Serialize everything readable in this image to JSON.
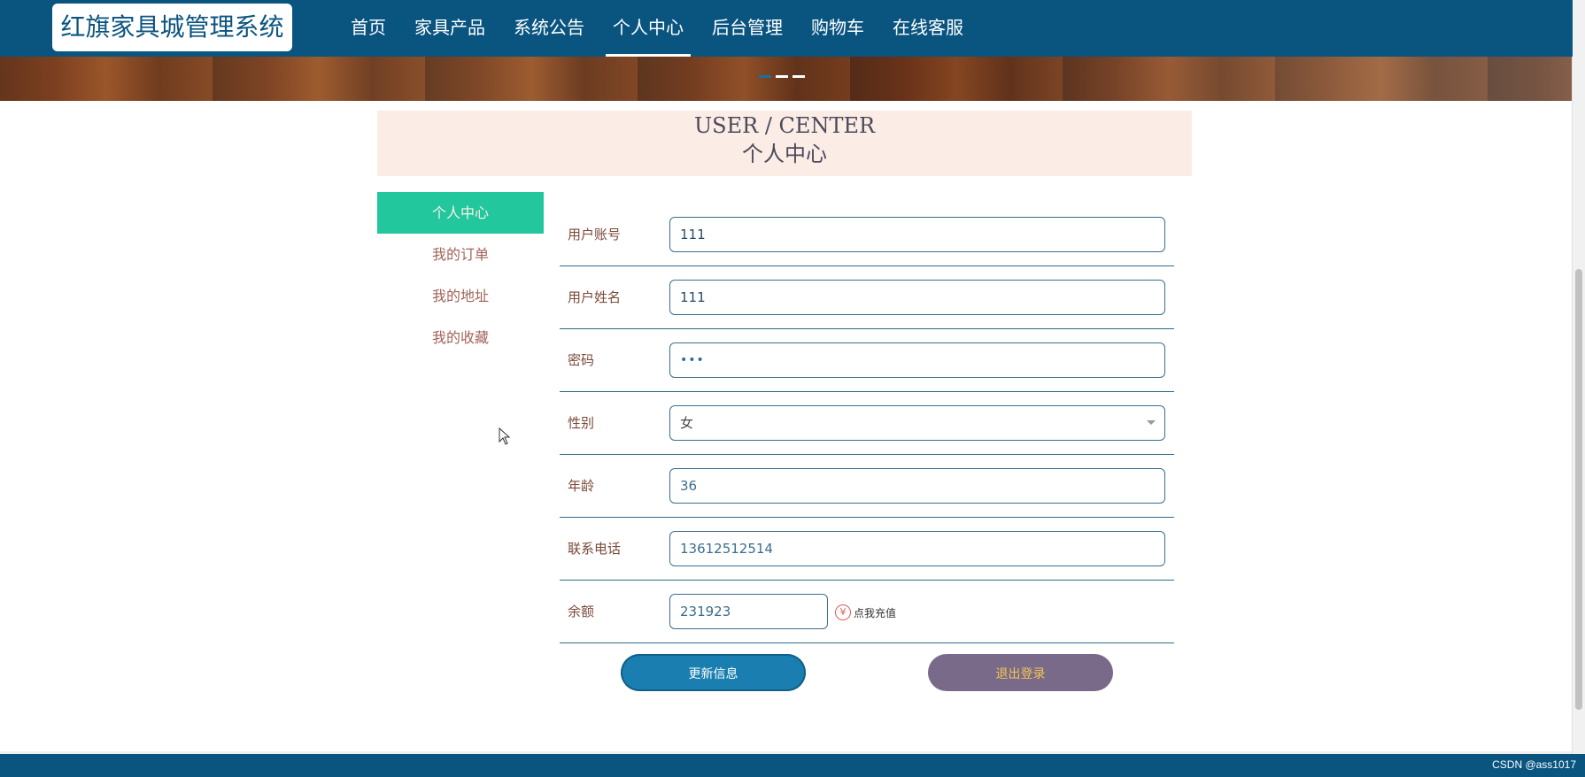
{
  "app": {
    "logo_text": "红旗家具城管理系统"
  },
  "nav": {
    "items": [
      {
        "label": "首页"
      },
      {
        "label": "家具产品"
      },
      {
        "label": "系统公告"
      },
      {
        "label": "个人中心"
      },
      {
        "label": "后台管理"
      },
      {
        "label": "购物车"
      },
      {
        "label": "在线客服"
      }
    ],
    "active_index": 3
  },
  "header": {
    "en": "USER / CENTER",
    "zh": "个人中心"
  },
  "side_menu": {
    "items": [
      {
        "label": "个人中心"
      },
      {
        "label": "我的订单"
      },
      {
        "label": "我的地址"
      },
      {
        "label": "我的收藏"
      }
    ],
    "active_index": 0
  },
  "form": {
    "account": {
      "label": "用户账号",
      "value": "111"
    },
    "name": {
      "label": "用户姓名",
      "value": "111"
    },
    "password": {
      "label": "密码",
      "value": "•••"
    },
    "gender": {
      "label": "性别",
      "value": "女"
    },
    "age": {
      "label": "年龄",
      "value": "36"
    },
    "phone": {
      "label": "联系电话",
      "value": "13612512514"
    },
    "balance": {
      "label": "余额",
      "value": "231923",
      "recharge_symbol": "¥",
      "recharge_label": "点我充值"
    }
  },
  "buttons": {
    "update": "更新信息",
    "logout": "退出登录"
  },
  "footer": {
    "credit": "CSDN @ass1017"
  },
  "colors": {
    "nav_bg": "#0a5480",
    "active_menu": "#22c79e",
    "update_button": "#1a7fb0",
    "logout_button": "#7a6a8a",
    "header_bg": "#fcece6"
  }
}
